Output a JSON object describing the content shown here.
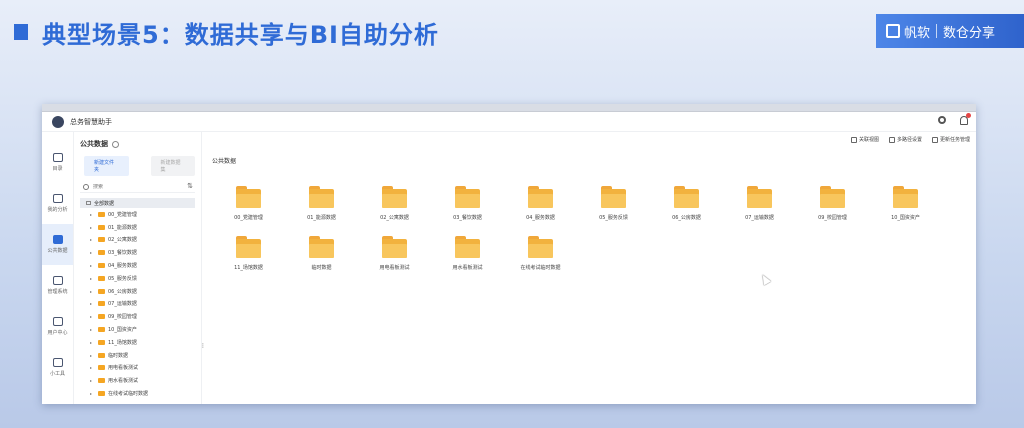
{
  "slide": {
    "title": "典型场景5：数据共享与BI自助分析",
    "brand_name": "帆软",
    "brand_tagline": "数仓分享"
  },
  "app": {
    "name": "总务智慧助手"
  },
  "nav": [
    {
      "label": "目录",
      "icon": "catalog-icon",
      "active": false
    },
    {
      "label": "我的分析",
      "icon": "chart-icon",
      "active": false
    },
    {
      "label": "公共数据",
      "icon": "database-icon",
      "active": true
    },
    {
      "label": "管理系统",
      "icon": "manage-icon",
      "active": false
    },
    {
      "label": "用户中心",
      "icon": "user-icon",
      "active": false
    },
    {
      "label": "小工具",
      "icon": "tool-icon",
      "active": false
    }
  ],
  "tree": {
    "title": "公共数据",
    "new_folder_button": "新建文件夹",
    "disabled_button": "新建数据集",
    "search_placeholder": "搜索",
    "root_label": "全部数据",
    "items": [
      "00_党建管理",
      "01_能源数据",
      "02_公寓数据",
      "03_餐饮数据",
      "04_服务数据",
      "05_服务反馈",
      "06_公房数据",
      "07_运输数据",
      "09_校园管理",
      "10_国资资产",
      "11_场馆数据",
      "临时数据",
      "用电看板测试",
      "用水看板测试",
      "在线考试临时数据"
    ]
  },
  "toolbar": {
    "items": [
      "关联视图",
      "多路径设置",
      "更新任务管理"
    ]
  },
  "main": {
    "section_title": "公共数据",
    "folders": [
      "00_党建管理",
      "01_能源数据",
      "02_公寓数据",
      "03_餐饮数据",
      "04_服务数据",
      "05_服务反馈",
      "06_公房数据",
      "07_运输数据",
      "09_校园管理",
      "10_国资资产",
      "11_场馆数据",
      "临时数据",
      "用电看板测试",
      "用水看板测试",
      "在线考试临时数据"
    ]
  },
  "colors": {
    "accent": "#2f6bd6",
    "folder": "#f5a623"
  }
}
